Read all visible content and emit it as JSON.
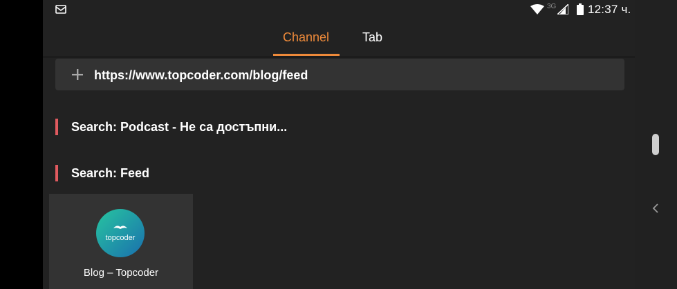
{
  "status_bar": {
    "network_label": "3G",
    "time": "12:37 ч."
  },
  "tabs": [
    {
      "label": "Channel",
      "active": true
    },
    {
      "label": "Tab",
      "active": false
    }
  ],
  "url_bar": {
    "value": "https://www.topcoder.com/blog/feed",
    "icon": "plus-icon"
  },
  "sections": [
    {
      "title": "Search: Podcast - Не са достъпни..."
    },
    {
      "title": "Search: Feed"
    }
  ],
  "cards": [
    {
      "title": "Blog – Topcoder",
      "logo_text": "topcoder"
    }
  ],
  "colors": {
    "accent": "#ee8a3a",
    "section_marker": "#e05a5f",
    "background": "#222222",
    "surface": "#333333"
  }
}
